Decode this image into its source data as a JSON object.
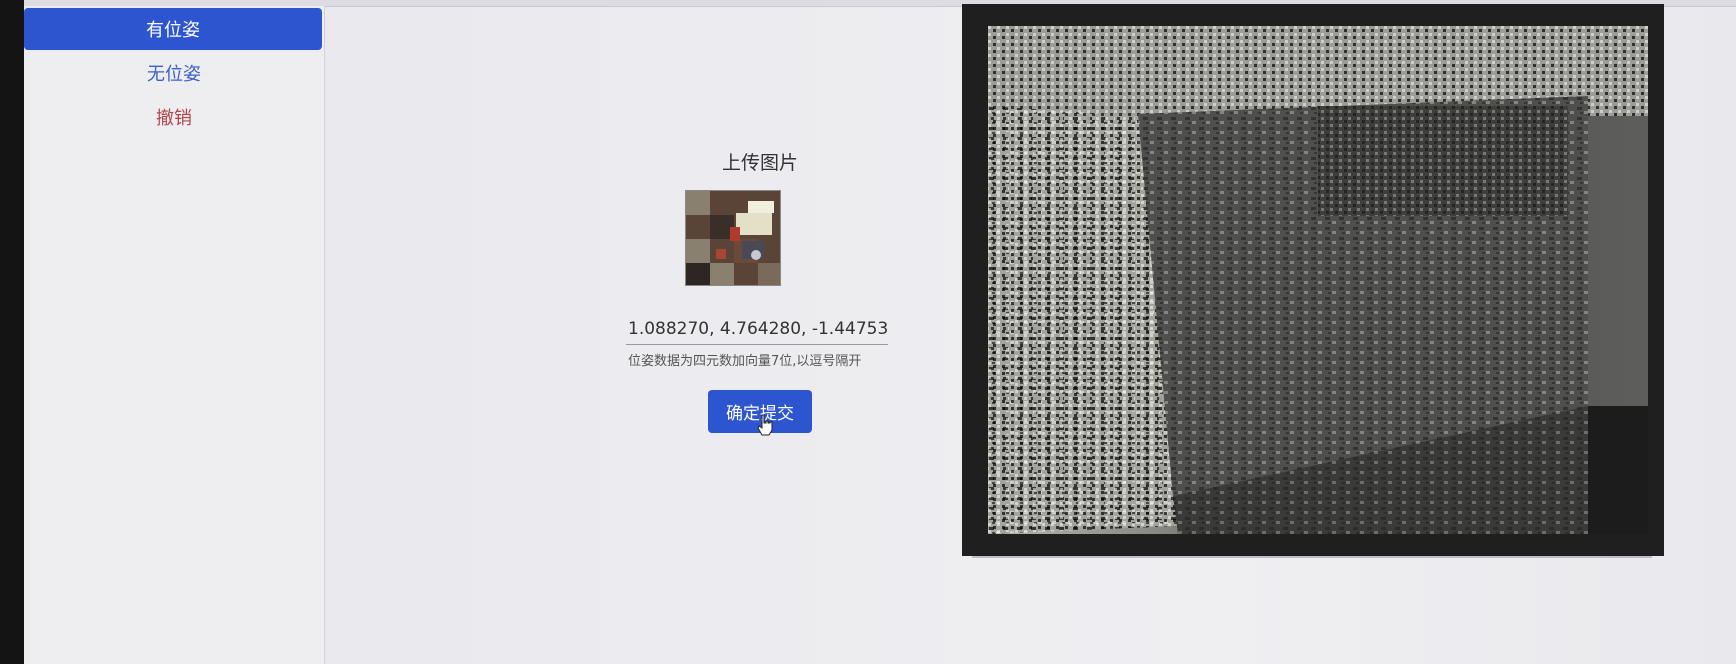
{
  "sidebar": {
    "items": [
      {
        "label": "有位姿",
        "active": true
      },
      {
        "label": "无位姿",
        "active": false
      },
      {
        "label": "撤销",
        "active": false
      }
    ]
  },
  "upload": {
    "title": "上传图片",
    "pose_value": "1.088270, 4.764280, -1.44753(",
    "hint": "位姿数据为四元数加向量7位,以逗号隔开",
    "submit_label": "确定提交"
  },
  "colors": {
    "accent": "#2c55cf",
    "danger_text": "#b0454d",
    "link_text": "#3a5fcf"
  },
  "icons": {
    "cursor": "hand-pointer-icon"
  }
}
